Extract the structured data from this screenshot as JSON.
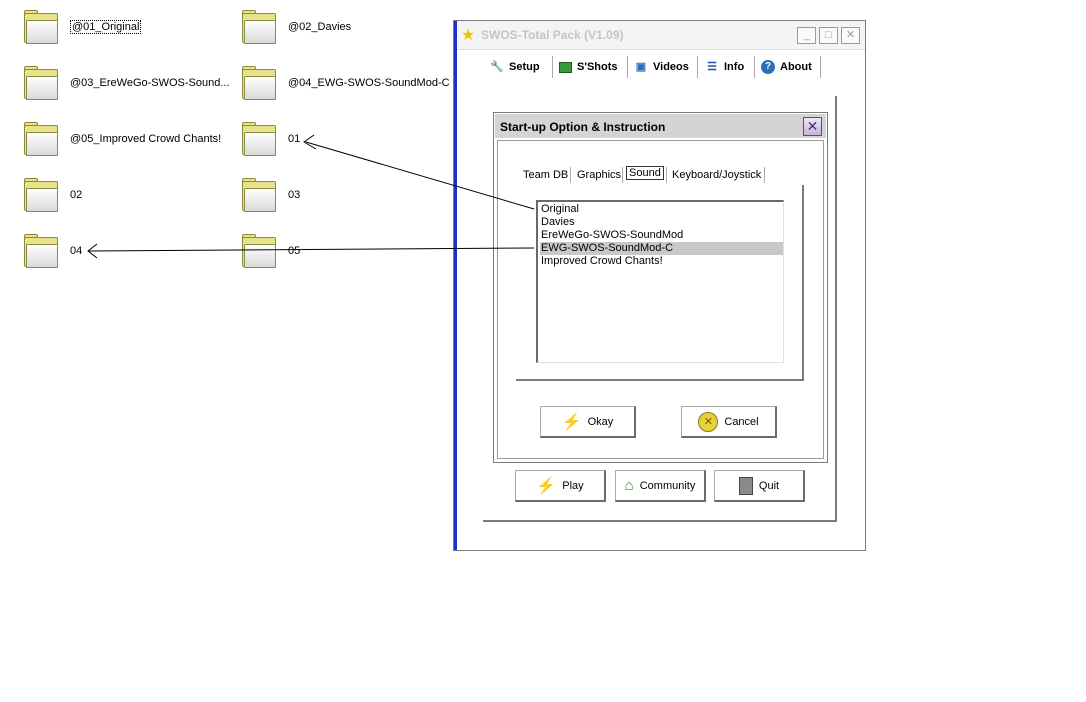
{
  "desktop": {
    "folders": [
      {
        "label": "@01_Original",
        "selected": true
      },
      {
        "label": "@02_Davies"
      },
      {
        "label": "@03_EreWeGo-SWOS-Sound..."
      },
      {
        "label": "@04_EWG-SWOS-SoundMod-C"
      },
      {
        "label": "@05_Improved Crowd Chants!"
      },
      {
        "label": "01"
      },
      {
        "label": "02"
      },
      {
        "label": "03"
      },
      {
        "label": "04"
      },
      {
        "label": "05"
      }
    ]
  },
  "window": {
    "title": "SWOS-Total Pack (V1.09)",
    "controls": {
      "minimize": "_",
      "maximize": "□",
      "close": "✕"
    },
    "tabs": [
      {
        "label": "Setup",
        "icon": "tools-icon"
      },
      {
        "label": "S'Shots",
        "icon": "picture-icon"
      },
      {
        "label": "Videos",
        "icon": "film-icon"
      },
      {
        "label": "Info",
        "icon": "list-icon"
      },
      {
        "label": "About",
        "icon": "help-icon"
      }
    ],
    "bottom_buttons": {
      "play": "Play",
      "community": "Community",
      "quit": "Quit"
    }
  },
  "dialog": {
    "title": "Start-up Option & Instruction",
    "close": "✕",
    "subtabs": [
      "Team DB",
      "Graphics",
      "Sound",
      "Keyboard/Joystick"
    ],
    "selected_subtab": "Sound",
    "sound_options": [
      "Original",
      "Davies",
      "EreWeGo-SWOS-SoundMod",
      "EWG-SWOS-SoundMod-C",
      "Improved Crowd Chants!"
    ],
    "selected_option": "EWG-SWOS-SoundMod-C",
    "okay_label": "Okay",
    "cancel_label": "Cancel"
  },
  "colors": {
    "window_left_edge": "#1a33c2",
    "list_selection": "#c8c8c8",
    "title_text": "#c4c4c4"
  }
}
